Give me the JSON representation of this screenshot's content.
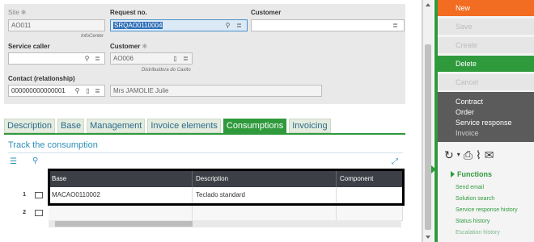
{
  "form": {
    "site": {
      "label": "Site",
      "value": "AO011",
      "sub": "InfoCenter"
    },
    "request_no": {
      "label": "Request no.",
      "value": "SRQAO0110004"
    },
    "customer_top": {
      "label": "Customer",
      "value": ""
    },
    "service_caller": {
      "label": "Service caller",
      "value": ""
    },
    "customer": {
      "label": "Customer",
      "value": "AO006",
      "sub": "Distribuidora do Caxito"
    },
    "contact": {
      "label": "Contact (relationship)",
      "value": "000000000000001",
      "name": "Mrs JAMOLIE Julie"
    }
  },
  "tabs": [
    {
      "label": "Description"
    },
    {
      "label": "Base"
    },
    {
      "label": "Management"
    },
    {
      "label": "Invoice elements"
    },
    {
      "label": "Consumptions",
      "active": true
    },
    {
      "label": "Invoicing"
    }
  ],
  "section": {
    "title": "Track the consumption"
  },
  "grid": {
    "columns": [
      "Base",
      "Description",
      "Component"
    ],
    "rows": [
      {
        "num": "1",
        "base": "MACAO0110002",
        "description": "Teclado standard",
        "component": ""
      },
      {
        "num": "2",
        "base": "",
        "description": "",
        "component": ""
      }
    ]
  },
  "actions": {
    "new": "New",
    "save": "Save",
    "create": "Create",
    "delete": "Delete",
    "cancel": "Cancel",
    "links": [
      "Contract",
      "Order",
      "Service response",
      "Invoice"
    ]
  },
  "functions": {
    "title": "Functions",
    "items": [
      "Send email",
      "Solution search",
      "Service response history",
      "Status history",
      "Escalation history"
    ]
  },
  "colors": {
    "accent_green": "#2f9a3c",
    "accent_orange": "#f26c21",
    "link_blue": "#2c8fb8"
  }
}
